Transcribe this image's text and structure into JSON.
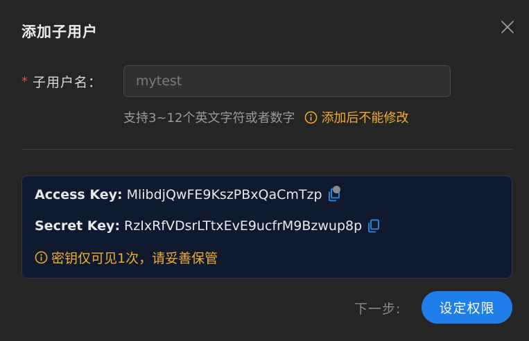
{
  "dialog": {
    "title": "添加子用户",
    "close_icon": "close-icon"
  },
  "form": {
    "required_mark": "*",
    "username_label": "子用户名：",
    "username_placeholder": "mytest",
    "username_value": "",
    "hint": "支持3~12个英文字符或者数字",
    "warning": "添加后不能修改",
    "warning_color": "#f2ac2e"
  },
  "keys": {
    "access_key_label": "Access Key:",
    "access_key_value": "MlibdjQwFE9KszPBxQaCmTzp",
    "secret_key_label": "Secret Key:",
    "secret_key_value": "RzIxRfVDsrLTtxEvE9ucfrM9Bzwup8p",
    "notice": "密钥仅可见1次，请妥善保管",
    "copy_icon": "copy-icon"
  },
  "footer": {
    "next_label": "下一步:",
    "button_label": "设定权限",
    "button_color": "#1f7eea"
  }
}
